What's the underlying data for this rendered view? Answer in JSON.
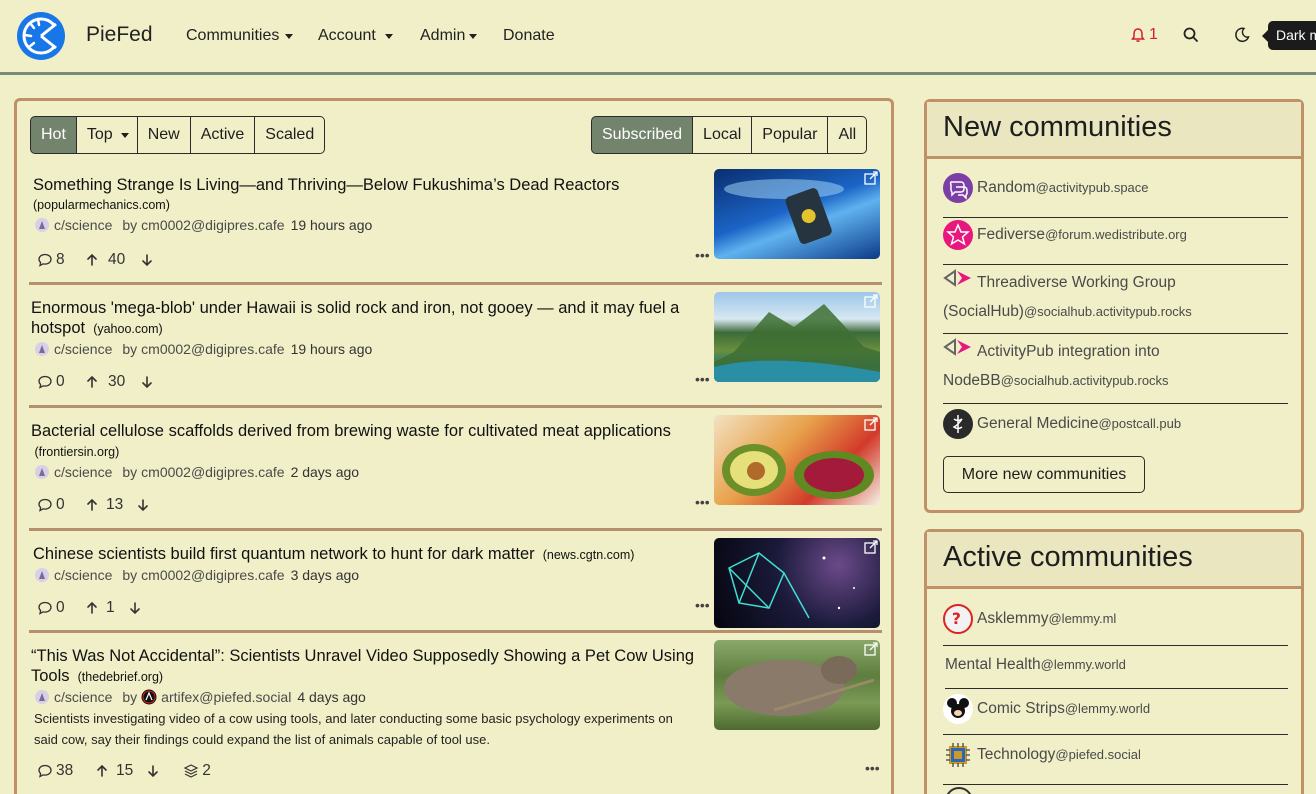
{
  "navbar": {
    "brand": "PieFed",
    "menu": [
      "Communities",
      "Account",
      "Admin",
      "Donate"
    ],
    "notifications_count": "1",
    "tooltip": "Dark mode"
  },
  "feed": {
    "sort_tabs": [
      "Hot",
      "Top",
      "New",
      "Active",
      "Scaled"
    ],
    "active_sort": "Hot",
    "scope_tabs": [
      "Subscribed",
      "Local",
      "Popular",
      "All"
    ],
    "active_scope": "Subscribed",
    "posts": [
      {
        "title": "Something Strange Is Living—and Thriving—Below Fukushima’s Dead Reactors",
        "domain": "popularmechanics.com",
        "community": "c/science",
        "by": "by",
        "author": "cm0002@digipres.cafe",
        "time": "19 hours ago",
        "comments": "8",
        "score": "40"
      },
      {
        "title": "Enormous 'mega-blob' under Hawaii is solid rock and iron, not gooey — and it may fuel a hotspot",
        "domain": "yahoo.com",
        "community": "c/science",
        "by": "by",
        "author": "cm0002@digipres.cafe",
        "time": "19 hours ago",
        "comments": "0",
        "score": "30"
      },
      {
        "title": "Bacterial cellulose scaffolds derived from brewing waste for cultivated meat applications",
        "domain": "frontiersin.org",
        "community": "c/science",
        "by": "by",
        "author": "cm0002@digipres.cafe",
        "time": "2 days ago",
        "comments": "0",
        "score": "13"
      },
      {
        "title": "Chinese scientists build first quantum network to hunt for dark matter",
        "domain": "news.cgtn.com",
        "community": "c/science",
        "by": "by",
        "author": "cm0002@digipres.cafe",
        "time": "3 days ago",
        "comments": "0",
        "score": "1"
      },
      {
        "title": "“This Was Not Accidental”: Scientists Unravel Video Supposedly Showing a Pet Cow Using Tools",
        "domain": "thedebrief.org",
        "community": "c/science",
        "by": "by",
        "author": "artifex@piefed.social",
        "time": "4 days ago",
        "body": "Scientists investigating video of a cow using tools, and later conducting some basic psychology experiments on said cow, say their findings could expand the list of animals capable of tool use.",
        "comments": "38",
        "score": "15",
        "crossposts": "2"
      }
    ]
  },
  "new_communities": {
    "title": "New communities",
    "items": [
      {
        "name": "Random",
        "instance": "@activitypub.space"
      },
      {
        "name": "Fediverse",
        "instance": "@forum.wedistribute.org"
      },
      {
        "name_line1": "Threadiverse Working Group",
        "name_line2": "(SocialHub)",
        "instance": "@socialhub.activitypub.rocks"
      },
      {
        "name_line1": "ActivityPub integration into",
        "name_line2": "NodeBB",
        "instance": "@socialhub.activitypub.rocks"
      },
      {
        "name": "General Medicine",
        "instance": "@postcall.pub"
      }
    ],
    "more_label": "More new communities"
  },
  "active_communities": {
    "title": "Active communities",
    "items": [
      {
        "name": "Asklemmy",
        "instance": "@lemmy.ml"
      },
      {
        "name": "Mental Health",
        "instance": "@lemmy.world"
      },
      {
        "name": "Comic Strips",
        "instance": "@lemmy.world"
      },
      {
        "name": "Technology",
        "instance": "@piefed.social"
      }
    ]
  },
  "colors": {
    "background": "#f0efc7",
    "accent": "#73846c",
    "border": "#c09168",
    "notification": "#d6202a"
  }
}
